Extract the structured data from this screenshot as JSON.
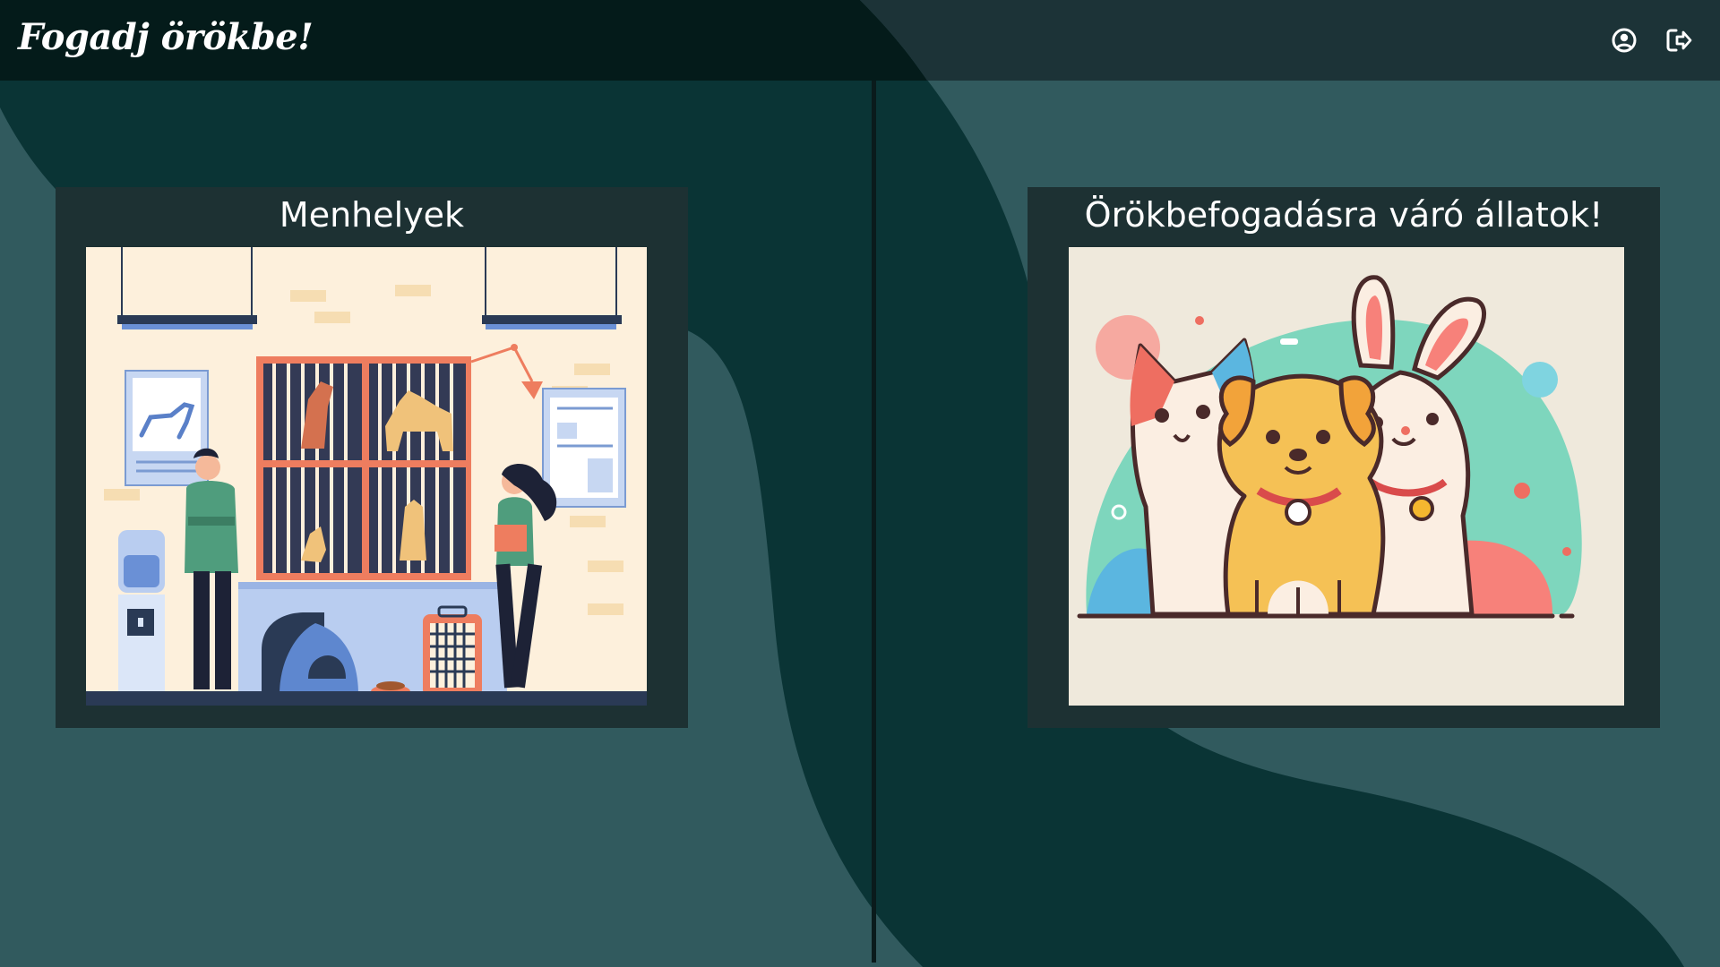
{
  "header": {
    "logo": "Fogadj örökbe!",
    "profile_icon": "user-circle-icon",
    "logout_icon": "sign-out-icon"
  },
  "cards": {
    "shelters": {
      "title": "Menhelyek",
      "image": "shelter-illustration"
    },
    "animals": {
      "title": "Örökbefogadásra váró állatok!",
      "image": "pets-illustration"
    }
  },
  "colors": {
    "background": "#315a5e",
    "dark_shape": "#0a3435",
    "header": "#0a1f20",
    "card": "#1d3133"
  }
}
